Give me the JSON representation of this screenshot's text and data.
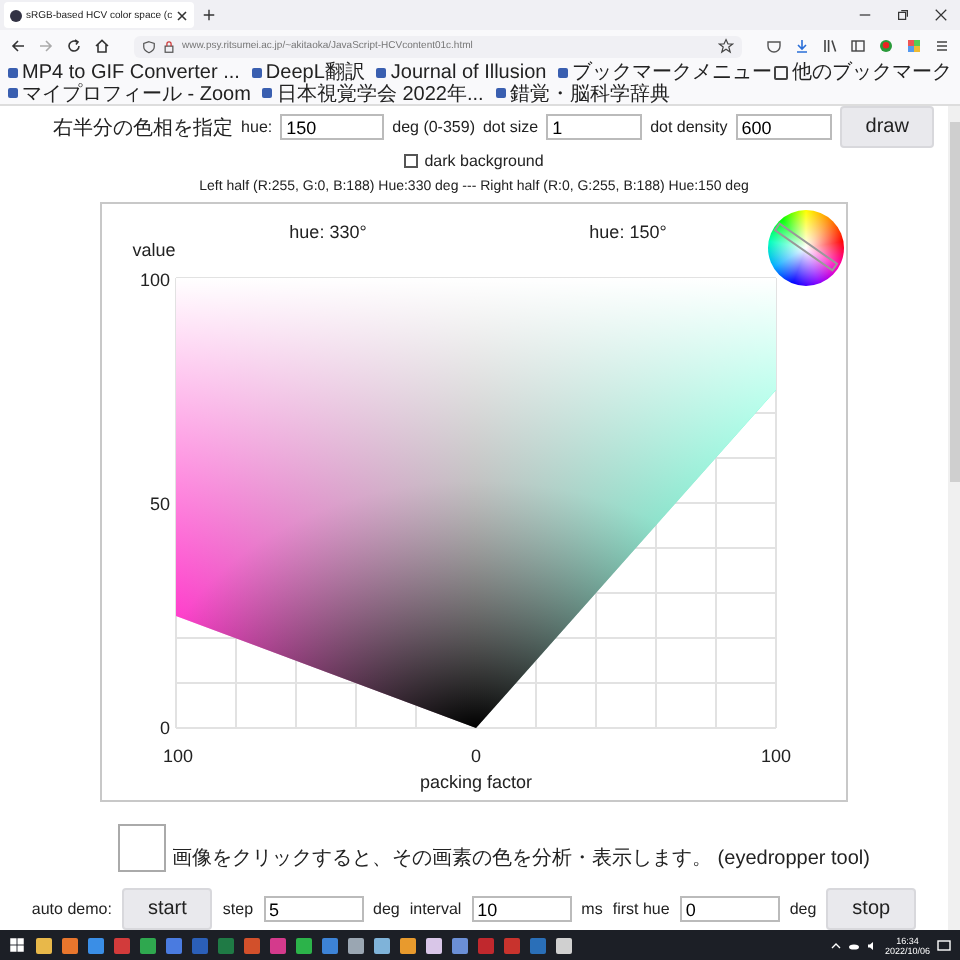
{
  "browser": {
    "tab_title": "sRGB-based HCV color space (c",
    "url": "www.psy.ritsumei.ac.jp/~akitaoka/JavaScript-HCVcontent01c.html",
    "bookmarks": [
      {
        "label": "MP4 to GIF Converter ..."
      },
      {
        "label": "DeepL翻訳"
      },
      {
        "label": "Journal of Illusion"
      },
      {
        "label": "ブックマークメニュー"
      },
      {
        "label": "マイプロフィール - Zoom"
      },
      {
        "label": "日本視覚学会 2022年..."
      },
      {
        "label": "錯覚・脳科学辞典"
      }
    ],
    "other_bookmarks": "他のブックマーク"
  },
  "controls": {
    "label": "右半分の色相を指定",
    "hue_label": "hue:",
    "hue_value": "150",
    "hue_unit": "deg (0-359)",
    "dot_size_label": "dot size",
    "dot_size_value": "1",
    "dot_density_label": "dot density",
    "dot_density_value": "600",
    "draw_button": "draw"
  },
  "dark_background": {
    "label": "dark background",
    "checked": false
  },
  "info": "Left half (R:255, G:0, B:188) Hue:330 deg --- Right half (R:0, G:255, B:188) Hue:150 deg",
  "chart": {
    "hue_left": "hue: 330°",
    "hue_right": "hue: 150°",
    "ylabel": "value",
    "yticks": [
      "100",
      "50",
      "0"
    ],
    "xticks": [
      "100",
      "0",
      "100"
    ],
    "xlabel": "packing factor"
  },
  "eyedropper": {
    "text": "画像をクリックすると、その画素の色を分析・表示します。 (eyedropper tool)"
  },
  "demo": {
    "label": "auto demo:",
    "start_button": "start",
    "step_label": "step",
    "step_value": "5",
    "step_unit": "deg",
    "interval_label": "interval",
    "interval_value": "10",
    "interval_unit": "ms",
    "first_hue_label": "first hue",
    "first_hue_value": "0",
    "first_hue_unit": "deg",
    "stop_button": "stop"
  },
  "taskbar": {
    "time": "16:34",
    "date": "2022/10/06"
  }
}
